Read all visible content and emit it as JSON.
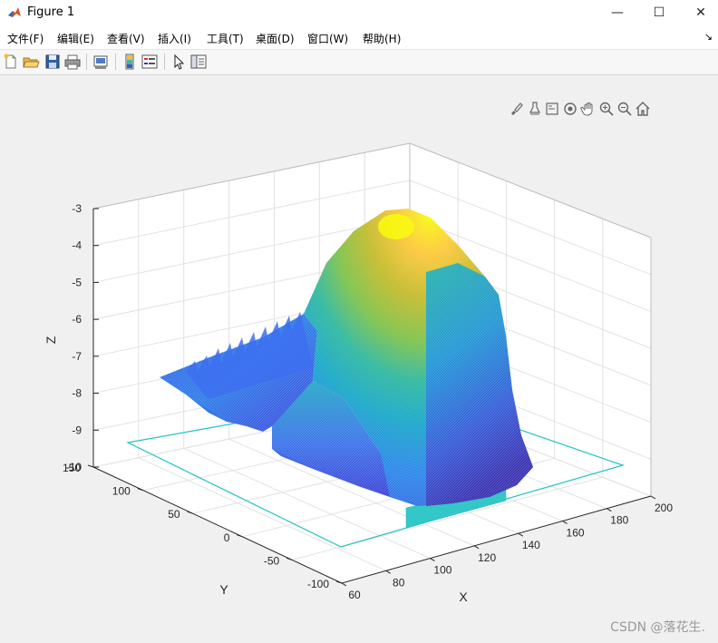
{
  "window": {
    "title": "Figure 1",
    "minimize": "—",
    "maximize": "☐",
    "close": "✕"
  },
  "menu": {
    "items": [
      "文件(F)",
      "编辑(E)",
      "查看(V)",
      "插入(I)",
      "工具(T)",
      "桌面(D)",
      "窗口(W)",
      "帮助(H)"
    ],
    "corner": "↘"
  },
  "toolbar": {
    "buttons": [
      "new-figure-icon",
      "open-icon",
      "save-icon",
      "print-icon",
      "link-plot-icon",
      "insert-colorbar-icon",
      "insert-legend-icon",
      "edit-plot-icon",
      "property-inspector-icon"
    ]
  },
  "axes_toolbar": {
    "buttons": [
      "brush-icon",
      "data-tips-icon",
      "datacursor-icon",
      "rotate-icon",
      "pan-icon",
      "zoom-in-icon",
      "zoom-out-icon",
      "home-icon"
    ]
  },
  "chart_data": {
    "type": "surface",
    "xlabel": "X",
    "ylabel": "Y",
    "zlabel": "Z",
    "x_ticks": [
      "60",
      "80",
      "100",
      "120",
      "140",
      "160",
      "180",
      "200"
    ],
    "y_ticks": [
      "-100",
      "-50",
      "0",
      "50",
      "100",
      "150"
    ],
    "z_ticks": [
      "-10",
      "-9",
      "-8",
      "-7",
      "-6",
      "-5",
      "-4",
      "-3"
    ],
    "xlim": [
      60,
      200
    ],
    "ylim": [
      -100,
      150
    ],
    "zlim": [
      -10,
      -3
    ],
    "grid": true,
    "colormap": "parula",
    "z_peak": -3.1,
    "z_min": -10
  },
  "watermark": "CSDN @落花生."
}
